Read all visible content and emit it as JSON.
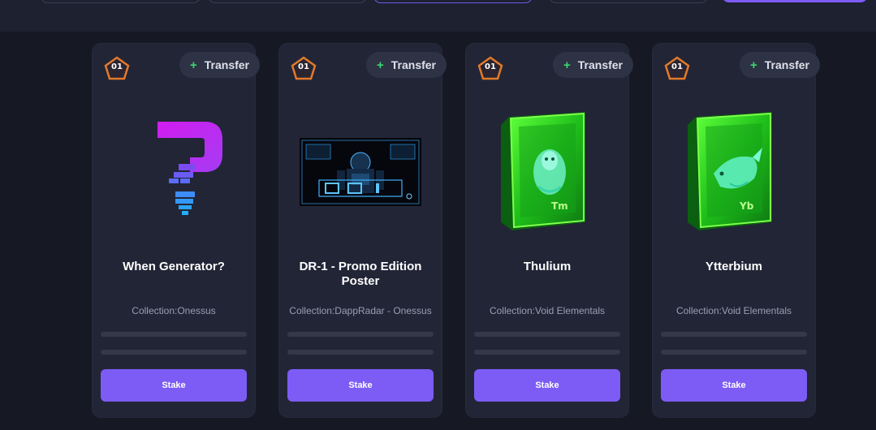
{
  "cards": [
    {
      "badge": "01",
      "transfer_label": "Transfer",
      "title": "When Generator?",
      "collection": "Collection:Onessus",
      "stake_label": "Stake",
      "art_icon": "question-mark-art"
    },
    {
      "badge": "01",
      "transfer_label": "Transfer",
      "title": "DR-1 - Promo Edition Poster",
      "collection": "Collection:DappRadar - Onessus",
      "stake_label": "Stake",
      "art_icon": "robot-poster-art"
    },
    {
      "badge": "01",
      "transfer_label": "Transfer",
      "title": "Thulium",
      "collection": "Collection:Void Elementals",
      "stake_label": "Stake",
      "art_icon": "element-card-art",
      "element_symbol": "Tm"
    },
    {
      "badge": "01",
      "transfer_label": "Transfer",
      "title": "Ytterbium",
      "collection": "Collection:Void Elementals",
      "stake_label": "Stake",
      "art_icon": "element-card-art",
      "element_symbol": "Yb"
    }
  ],
  "colors": {
    "accent": "#7c5cf5",
    "plus": "#39d96b",
    "badge_border": "#e27a2a",
    "card_bg": "#222536",
    "page_bg": "#161823"
  }
}
